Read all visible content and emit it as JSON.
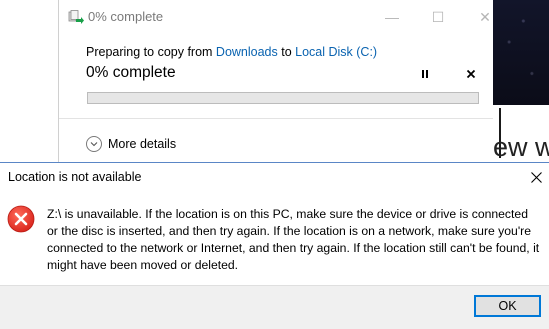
{
  "progress_window": {
    "title": "0% complete",
    "caption_buttons": {
      "minimize": "—",
      "maximize": "☐",
      "close": "✕"
    },
    "heading": {
      "prefix": "Preparing to copy from ",
      "source": "Downloads",
      "middle": " to ",
      "destination": "Local Disk (C:)"
    },
    "percent_text": "0% complete",
    "progress": 0,
    "more_details_label": "More details",
    "colors": {
      "link": "#0a63b0",
      "bar_track": "#e6e6e6"
    }
  },
  "background": {
    "partial_text": "ew w"
  },
  "dialog": {
    "title": "Location is not available",
    "close_glyph": "✕",
    "icon": "error-icon",
    "message": "Z:\\ is unavailable. If the location is on this PC, make sure the device or drive is connected or the disc is inserted, and then try again. If the location is on a network, make sure you're connected to the network or Internet, and then try again. If the location still can't be found, it might have been moved or deleted.",
    "ok_label": "OK",
    "colors": {
      "error_red": "#e81123",
      "button_focus": "#0078d7"
    }
  }
}
